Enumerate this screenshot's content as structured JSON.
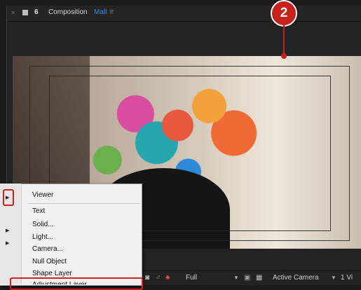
{
  "composition_panel": {
    "close_icon": "×",
    "lock_icon": "lock-icon",
    "label": "6",
    "title_prefix": "Composition",
    "title_name": "Mall",
    "menu_icon": "≡"
  },
  "viewer_toolbar": {
    "camera_icon": "◙",
    "snapshot_icon": "♂",
    "color_icon": "♣",
    "resolution": "Full",
    "dropdown": "▼",
    "region_icon": "▣",
    "grid_icon": "▦",
    "active_camera": "Active Camera",
    "views": "1 Vi"
  },
  "context_menu": {
    "arrow": "▶",
    "items": [
      "Viewer",
      "Text",
      "Solid...",
      "Light...",
      "Camera...",
      "Null Object",
      "Shape Layer",
      "Adjustment Layer"
    ]
  },
  "callout": {
    "number": "2"
  },
  "colors": {
    "accent": "#2d8ceb",
    "callout": "#c8211b"
  }
}
